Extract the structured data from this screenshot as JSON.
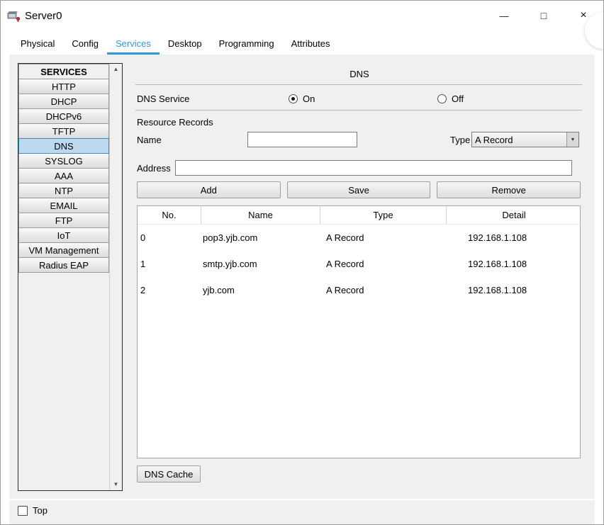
{
  "window": {
    "title": "Server0",
    "controls": {
      "minimize": "—",
      "maximize": "□",
      "close": "×"
    }
  },
  "icons": {
    "scroll_up": "▲",
    "scroll_down": "▼",
    "combo_arrow": "▼"
  },
  "tabs": [
    {
      "label": "Physical",
      "active": false
    },
    {
      "label": "Config",
      "active": false
    },
    {
      "label": "Services",
      "active": true
    },
    {
      "label": "Desktop",
      "active": false
    },
    {
      "label": "Programming",
      "active": false
    },
    {
      "label": "Attributes",
      "active": false
    }
  ],
  "sidebar": {
    "header": "SERVICES",
    "items": [
      {
        "label": "HTTP",
        "active": false
      },
      {
        "label": "DHCP",
        "active": false
      },
      {
        "label": "DHCPv6",
        "active": false
      },
      {
        "label": "TFTP",
        "active": false
      },
      {
        "label": "DNS",
        "active": true
      },
      {
        "label": "SYSLOG",
        "active": false
      },
      {
        "label": "AAA",
        "active": false
      },
      {
        "label": "NTP",
        "active": false
      },
      {
        "label": "EMAIL",
        "active": false
      },
      {
        "label": "FTP",
        "active": false
      },
      {
        "label": "IoT",
        "active": false
      },
      {
        "label": "VM Management",
        "active": false
      },
      {
        "label": "Radius EAP",
        "active": false
      }
    ]
  },
  "dns": {
    "panel_title": "DNS",
    "service_label": "DNS Service",
    "on_label": "On",
    "off_label": "Off",
    "service_state": "On",
    "resource_records_label": "Resource Records",
    "name_label": "Name",
    "name_value": "",
    "type_label": "Type",
    "type_value": "A Record",
    "address_label": "Address",
    "address_value": "",
    "add_button": "Add",
    "save_button": "Save",
    "remove_button": "Remove",
    "table": {
      "headers": [
        "No.",
        "Name",
        "Type",
        "Detail"
      ],
      "records": [
        {
          "no": "0",
          "name": "pop3.yjb.com",
          "type": "A Record",
          "detail": "192.168.1.108"
        },
        {
          "no": "1",
          "name": "smtp.yjb.com",
          "type": "A Record",
          "detail": "192.168.1.108"
        },
        {
          "no": "2",
          "name": "yjb.com",
          "type": "A Record",
          "detail": "192.168.1.108"
        }
      ]
    },
    "dns_cache_button": "DNS Cache"
  },
  "footer": {
    "top_label": "Top",
    "top_checked": false
  },
  "colors": {
    "accent": "#2e9bd6",
    "selected_service_bg": "#bcd9f0",
    "selected_service_border": "#3f8ac2"
  }
}
